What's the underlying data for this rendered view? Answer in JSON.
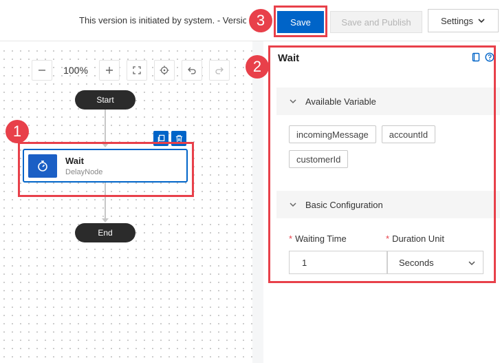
{
  "topbar": {
    "version_text": "This version is initiated by system. - Version",
    "save_label": "Save",
    "publish_label": "Save and Publish",
    "settings_label": "Settings"
  },
  "canvas": {
    "zoom_level": "100%",
    "start_label": "Start",
    "end_label": "End",
    "wait_node": {
      "title": "Wait",
      "subtitle": "DelayNode"
    }
  },
  "panel": {
    "title": "Wait",
    "available_variable": {
      "title": "Available Variable",
      "variables": [
        "incomingMessage",
        "accountId",
        "customerId"
      ]
    },
    "basic_configuration": {
      "title": "Basic Configuration",
      "waiting_time_label": "Waiting Time",
      "waiting_time_value": "1",
      "duration_unit_label": "Duration Unit",
      "duration_unit_value": "Seconds"
    }
  },
  "callouts": {
    "one": "1",
    "two": "2",
    "three": "3"
  },
  "colors": {
    "accent": "#0064c8",
    "callout": "#e8404a",
    "node_dark": "#2b2b2b"
  }
}
